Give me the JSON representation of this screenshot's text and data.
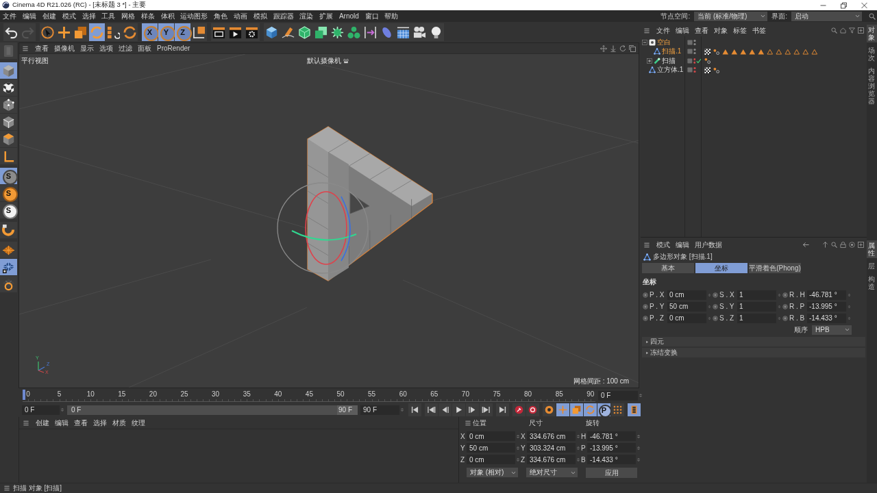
{
  "window": {
    "title": "Cinema 4D R21.026 (RC) - [未标题 3 *] - 主要"
  },
  "menu_bar": {
    "items": [
      "文件",
      "编辑",
      "创建",
      "模式",
      "选择",
      "工具",
      "网格",
      "样条",
      "体积",
      "运动图形",
      "角色",
      "动画",
      "模拟",
      "跟踪器",
      "渲染",
      "扩展",
      "Arnold",
      "窗口",
      "帮助"
    ],
    "node_space": {
      "label": "节点空间:",
      "value": "当前 (标准/物理)"
    },
    "layout": {
      "label": "界面:",
      "value": "启动"
    }
  },
  "toolbar": {
    "groups": [
      {
        "buttons": [
          {
            "kind": "undo",
            "selected": false
          },
          {
            "kind": "redo",
            "selected": false
          }
        ]
      },
      {
        "buttons": [
          {
            "kind": "live-select",
            "selected": false
          },
          {
            "kind": "move",
            "selected": false
          },
          {
            "kind": "scale",
            "selected": false
          },
          {
            "kind": "rotate",
            "selected": true
          },
          {
            "kind": "psr",
            "selected": false
          },
          {
            "kind": "recent-tool",
            "selected": false
          }
        ]
      },
      {
        "buttons": [
          {
            "kind": "axis",
            "label": "X",
            "selected": true
          },
          {
            "kind": "axis",
            "label": "Y",
            "selected": true
          },
          {
            "kind": "axis",
            "label": "Z",
            "selected": true
          },
          {
            "kind": "coordinate-system",
            "selected": false
          }
        ]
      },
      {
        "buttons": [
          {
            "kind": "render-view",
            "selected": false
          },
          {
            "kind": "render",
            "selected": false
          },
          {
            "kind": "render-settings",
            "selected": false
          }
        ]
      },
      {
        "buttons": [
          {
            "kind": "cube",
            "selected": false
          },
          {
            "kind": "pen",
            "selected": false
          },
          {
            "kind": "subdivision",
            "selected": false
          },
          {
            "kind": "extrude",
            "selected": false
          },
          {
            "kind": "cloner",
            "selected": false
          },
          {
            "kind": "mograph",
            "selected": false
          },
          {
            "kind": "symmetry",
            "selected": false
          },
          {
            "kind": "deformer",
            "selected": false
          },
          {
            "kind": "floor",
            "selected": false
          },
          {
            "kind": "camera",
            "selected": false
          },
          {
            "kind": "light",
            "selected": false
          }
        ]
      }
    ]
  },
  "left_toolbar": {
    "groups": [
      {
        "buttons": [
          {
            "kind": "model-mode",
            "selected": false
          }
        ]
      },
      {
        "buttons": [
          {
            "kind": "object-mode",
            "selected": true
          },
          {
            "kind": "texture-mode",
            "selected": false
          },
          {
            "kind": "point-mode",
            "selected": false
          },
          {
            "kind": "edge-mode",
            "selected": false
          },
          {
            "kind": "polygon-mode",
            "selected": false
          },
          {
            "kind": "axis-mode",
            "selected": false
          }
        ]
      },
      {
        "buttons": [
          {
            "kind": "snap",
            "label": "S",
            "selected": true
          },
          {
            "kind": "snap-settings",
            "label": "S",
            "selected": false
          },
          {
            "kind": "quantize",
            "label": "S",
            "selected": false
          }
        ]
      },
      {
        "buttons": [
          {
            "kind": "magnet",
            "selected": false
          }
        ]
      },
      {
        "buttons": [
          {
            "kind": "workplane",
            "selected": false
          },
          {
            "kind": "workplane-locked",
            "selected": true
          },
          {
            "kind": "planar-workplane",
            "selected": false
          }
        ]
      }
    ]
  },
  "viewport": {
    "menu": [
      "查看",
      "摄像机",
      "显示",
      "选项",
      "过滤",
      "面板",
      "ProRender"
    ],
    "view_name": "平行视图",
    "camera": "默认摄像机",
    "grid_spacing": "网格间距 : 100 cm",
    "axis_labels": [
      "Y",
      "Z",
      "X"
    ]
  },
  "timeline": {
    "ticks": [
      "0",
      "5",
      "10",
      "15",
      "20",
      "25",
      "30",
      "35",
      "40",
      "45",
      "50",
      "55",
      "60",
      "65",
      "70",
      "75",
      "80",
      "85",
      "90"
    ],
    "level": 0,
    "current_frame": "0 F"
  },
  "playback": {
    "start": "0 F",
    "range": {
      "start": "0 F",
      "end": "90 F",
      "level": 1
    },
    "end": "90 F",
    "groups": [
      {
        "buttons": [
          {
            "kind": "go-start",
            "selected": false
          }
        ]
      },
      {
        "buttons": [
          {
            "kind": "prev-key",
            "selected": false
          },
          {
            "kind": "prev-frame",
            "selected": false
          },
          {
            "kind": "play",
            "selected": false
          },
          {
            "kind": "next-frame",
            "selected": false
          },
          {
            "kind": "next-key",
            "selected": false
          }
        ]
      },
      {
        "buttons": [
          {
            "kind": "go-end",
            "selected": false
          }
        ]
      },
      {
        "buttons": [
          {
            "kind": "record",
            "selected": false
          },
          {
            "kind": "auto-key",
            "selected": false
          }
        ]
      },
      {
        "buttons": [
          {
            "kind": "key-selection",
            "selected": false
          },
          {
            "kind": "key-position",
            "selected": true
          },
          {
            "kind": "key-scale",
            "selected": true
          },
          {
            "kind": "key-rotation",
            "selected": true
          },
          {
            "kind": "key-parameter",
            "label": "P",
            "selected": true
          },
          {
            "kind": "key-point-level",
            "selected": false
          }
        ]
      },
      {
        "buttons": [
          {
            "kind": "timeline",
            "selected": true
          }
        ]
      }
    ]
  },
  "material_manager": {
    "menu": [
      "创建",
      "编辑",
      "查看",
      "选择",
      "材质",
      "纹理"
    ]
  },
  "coordinates": {
    "headers": [
      "位置",
      "尺寸",
      "旋转"
    ],
    "rows": [
      {
        "position_axis": "X",
        "position": "0 cm",
        "size_axis": "X",
        "size": "334.676 cm",
        "rotation_axis": "H",
        "rotation": "-46.781 °"
      },
      {
        "position_axis": "Y",
        "position": "50 cm",
        "size_axis": "Y",
        "size": "303.324 cm",
        "rotation_axis": "P",
        "rotation": "-13.995 °"
      },
      {
        "position_axis": "Z",
        "position": "0 cm",
        "size_axis": "Z",
        "size": "334.676 cm",
        "rotation_axis": "B",
        "rotation": "-14.433 °"
      }
    ],
    "mode": "对象 (相对)",
    "size_mode": "绝对尺寸",
    "apply": "应用"
  },
  "object_manager": {
    "menu": [
      "文件",
      "编辑",
      "查看",
      "对象",
      "标签",
      "书签"
    ],
    "objects": [
      {
        "name": "空白",
        "kind": "null",
        "selected": true,
        "expanded": true,
        "hidden": false,
        "children": [
          {
            "name": "扫描.1",
            "kind": "polygon",
            "selected": true,
            "hidden": false,
            "tags": [
              {
                "kind": "texture"
              },
              {
                "kind": "phong"
              },
              {
                "kind": "selection-filled"
              },
              {
                "kind": "selection-filled"
              },
              {
                "kind": "selection-filled"
              },
              {
                "kind": "selection-filled"
              },
              {
                "kind": "selection-filled"
              },
              {
                "kind": "selection"
              },
              {
                "kind": "selection"
              },
              {
                "kind": "selection"
              },
              {
                "kind": "selection"
              },
              {
                "kind": "selection"
              },
              {
                "kind": "selection"
              }
            ]
          },
          {
            "name": "扫描",
            "kind": "sweep",
            "selected": false,
            "expanded": false,
            "hidden": true,
            "enabled": true,
            "tags": [
              {
                "kind": "phong"
              }
            ]
          }
        ]
      },
      {
        "name": "立方体.1",
        "kind": "polygon",
        "selected": false,
        "hidden": true,
        "tags": [
          {
            "kind": "texture"
          },
          {
            "kind": "phong"
          }
        ]
      }
    ]
  },
  "attribute_manager": {
    "menu": [
      "模式",
      "编辑",
      "用户数据"
    ],
    "title": "多边形对象 [扫描.1]",
    "tabs": [
      {
        "label": "基本",
        "selected": false
      },
      {
        "label": "坐标",
        "selected": true
      },
      {
        "label": "平滑着色(Phong)",
        "selected": false
      }
    ],
    "section": "坐标",
    "fields": [
      [
        {
          "label": "P . X",
          "value": "0 cm"
        },
        {
          "label": "S . X",
          "value": "1"
        },
        {
          "label": "R . H",
          "value": "-46.781 °"
        }
      ],
      [
        {
          "label": "P . Y",
          "value": "50 cm"
        },
        {
          "label": "S . Y",
          "value": "1"
        },
        {
          "label": "R . P",
          "value": "-13.995 °"
        }
      ],
      [
        {
          "label": "P . Z",
          "value": "0 cm"
        },
        {
          "label": "S . Z",
          "value": "1"
        },
        {
          "label": "R . B",
          "value": "-14.433 °"
        }
      ]
    ],
    "order": {
      "label": "顺序",
      "value": "HPB"
    },
    "groups": [
      {
        "label": "四元",
        "expanded": false
      },
      {
        "label": "冻结变换",
        "expanded": false
      }
    ]
  },
  "side_tabs": {
    "top": [
      {
        "label": "对象",
        "selected": true
      },
      {
        "label": "场次",
        "selected": false
      },
      {
        "label": "内容浏览器",
        "selected": false
      }
    ],
    "bottom": [
      {
        "label": "属性",
        "selected": true
      },
      {
        "label": "层",
        "selected": false
      },
      {
        "label": "构造",
        "selected": false
      }
    ]
  },
  "status_bar": {
    "text": "扫描 对象 [扫描]"
  }
}
